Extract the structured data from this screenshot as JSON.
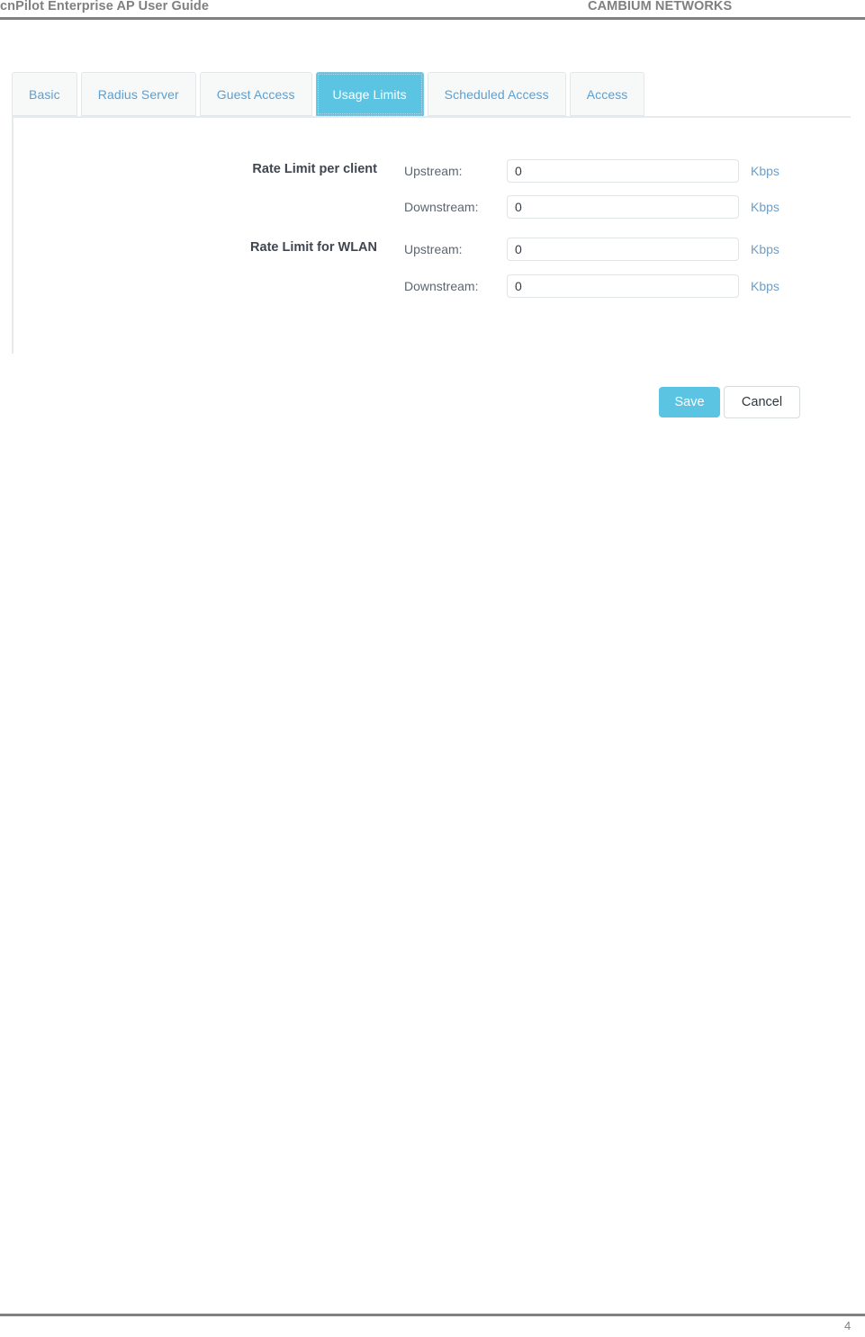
{
  "header": {
    "title": "cnPilot Enterprise AP User Guide",
    "brand": "CAMBIUM NETWORKS"
  },
  "footer": {
    "page_number": "4"
  },
  "colors": {
    "active_tab_bg": "#5bc4e2",
    "tab_text": "#5a9fd4",
    "save_button_bg": "#5bc4e2",
    "unit_label": "#6f9dc4",
    "rule": "#808080"
  },
  "panel": {
    "tabs": [
      {
        "label": "Basic",
        "active": false
      },
      {
        "label": "Radius Server",
        "active": false
      },
      {
        "label": "Guest Access",
        "active": false
      },
      {
        "label": "Usage Limits",
        "active": true
      },
      {
        "label": "Scheduled Access",
        "active": false
      },
      {
        "label": "Access",
        "active": false
      }
    ],
    "groups": [
      {
        "title": "Rate Limit per client",
        "rows": [
          {
            "label": "Upstream:",
            "value": "0",
            "placeholder": "",
            "unit": "Kbps"
          },
          {
            "label": "Downstream:",
            "value": "0",
            "placeholder": "",
            "unit": "Kbps"
          }
        ]
      },
      {
        "title": "Rate Limit for WLAN",
        "rows": [
          {
            "label": "Upstream:",
            "value": "0",
            "placeholder": "",
            "unit": "Kbps"
          },
          {
            "label": "Downstream:",
            "value": "0",
            "placeholder": "",
            "unit": "Kbps"
          }
        ]
      }
    ],
    "actions": {
      "save_label": "Save",
      "cancel_label": "Cancel"
    }
  }
}
